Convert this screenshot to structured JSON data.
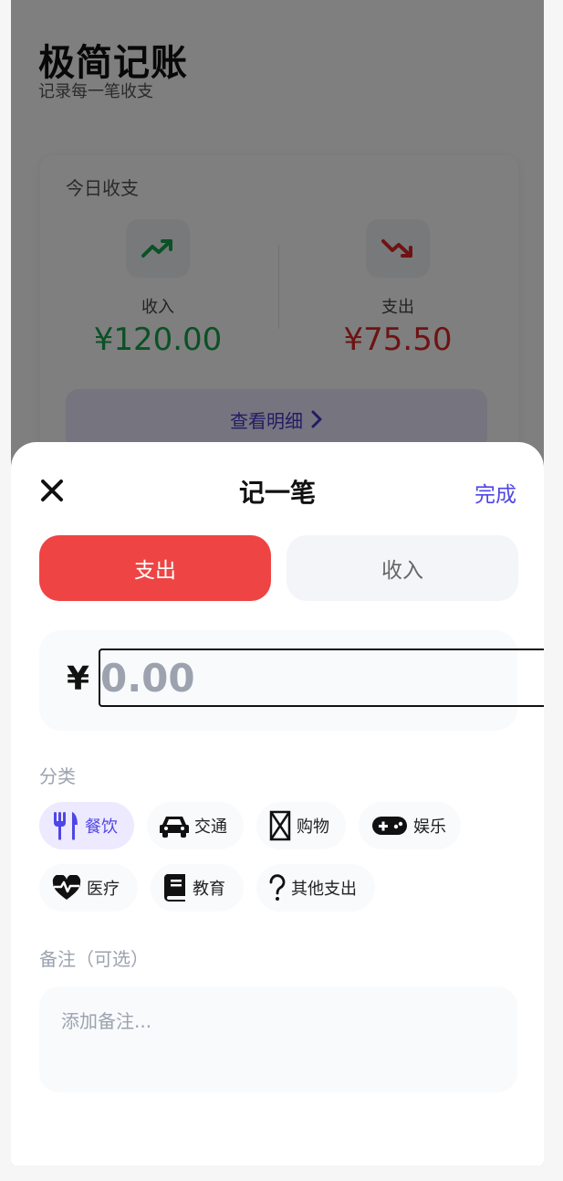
{
  "app": {
    "title": "极简记账",
    "subtitle": "记录每一笔收支"
  },
  "summary": {
    "title": "今日收支",
    "income": {
      "label": "收入",
      "value": "¥120.00",
      "icon": "trend-up-icon",
      "color": "#16a34a"
    },
    "expense": {
      "label": "支出",
      "value": "¥75.50",
      "icon": "trend-down-icon",
      "color": "#dc2626"
    },
    "detail_button": "查看明细"
  },
  "sheet": {
    "title": "记一笔",
    "done_label": "完成",
    "close_icon": "close-icon",
    "tabs": {
      "expense": "支出",
      "income": "收入"
    },
    "amount": {
      "currency": "¥",
      "placeholder": "0.00",
      "value": ""
    },
    "category_label": "分类",
    "categories": [
      {
        "label": "餐饮",
        "icon": "utensils-icon",
        "selected": true
      },
      {
        "label": "交通",
        "icon": "car-icon"
      },
      {
        "label": "购物",
        "icon": "shopping-icon"
      },
      {
        "label": "娱乐",
        "icon": "gamepad-icon"
      },
      {
        "label": "医疗",
        "icon": "heartbeat-icon"
      },
      {
        "label": "教育",
        "icon": "book-icon"
      },
      {
        "label": "其他支出",
        "icon": "question-icon"
      }
    ],
    "note_label": "备注（可选）",
    "note_placeholder": "添加备注..."
  },
  "colors": {
    "accent": "#4f46e5",
    "expense_red": "#ef4444",
    "income_green": "#16a34a",
    "chip_active_bg": "#ede9fe"
  }
}
